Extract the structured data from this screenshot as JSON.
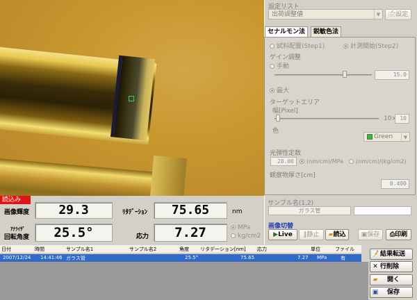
{
  "status": {
    "recording_label": "読込み"
  },
  "readouts": {
    "brightness_label": "画像輝度",
    "brightness_value": "29.3",
    "retardation_label": "ﾘﾀﾃﾞｰｼｮﾝ",
    "retardation_value": "75.65",
    "retardation_unit": "nm",
    "analyzer_label_line1": "ｱﾅﾗｲｻﾞ",
    "analyzer_label_line2": "回転角度",
    "analyzer_value": "25.5°",
    "stress_label": "応力",
    "stress_value": "7.27",
    "stress_unit_1": "MPa",
    "stress_unit_2": "kg/cm2"
  },
  "settings": {
    "list_label": "設定リスト",
    "list_selected": "出荷調整値",
    "settings_button": "設定"
  },
  "tabs": [
    "セナルモン法",
    "鋭敏色法"
  ],
  "senarmont": {
    "step1": "試料配置(Step1)",
    "step2": "計測開始(Step2)",
    "gain_label": "ゲイン調整",
    "manual_label": "手動",
    "manual_value": "15.0",
    "max_label": "最大",
    "target_label": "ターゲットエリア",
    "width_label": "幅[Pixel]",
    "width_value": "10",
    "width_prefix": "10×",
    "color_label": "色",
    "color_value": "Green",
    "color_swatch": "#2ac12a",
    "photoelastic_label": "光弾性定数",
    "photoelastic_value": "28.00",
    "unit_mm": "(nm/cm)/MPa",
    "unit_kg": "(nm/cm)/(kg/cm2)",
    "thickness_label": "観察物厚さ[cm]",
    "thickness_value": "0.400"
  },
  "sample": {
    "label": "サンプル名(1,2)",
    "name1": "ガラス管",
    "name2": ""
  },
  "image_switch": {
    "label": "画像切替",
    "live": "Live",
    "still": "静止",
    "load": "読込",
    "save": "保存",
    "print": "印刷"
  },
  "table": {
    "headers": [
      "日付",
      "時間",
      "サンプル名1",
      "サンプル名2",
      "角度",
      "リタデーション[nm]",
      "応力",
      "単位",
      "ファイル"
    ],
    "rows": [
      [
        "2007/12/24",
        "14:41:46",
        "ガラス管",
        "",
        "25.5°",
        "75.65",
        "7.27",
        "MPa",
        "有"
      ]
    ]
  },
  "side_buttons": {
    "transfer": "結果転送",
    "delete_row": "行削除",
    "open": "開く",
    "save": "保存"
  },
  "colors": {
    "accent_selected": "#3169c6",
    "record_badge": "#e11414",
    "target_box": "#22dd55"
  }
}
